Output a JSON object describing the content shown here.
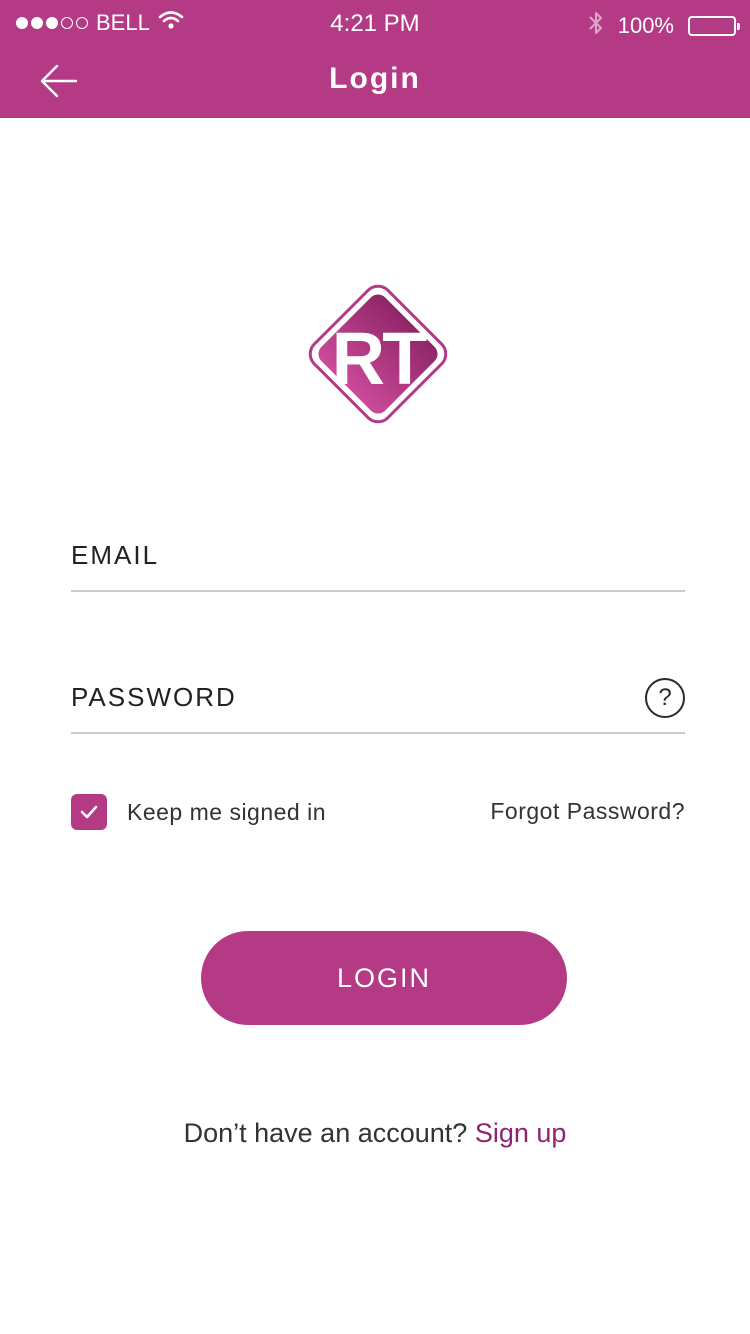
{
  "status_bar": {
    "carrier": "BELL",
    "time": "4:21 PM",
    "battery": "100%",
    "signal_bars_filled": 3,
    "signal_bars_total": 5
  },
  "navbar": {
    "title": "Login",
    "back_icon": "arrow-left-icon"
  },
  "logo": {
    "text": "RT",
    "color": "#b53a86"
  },
  "form": {
    "email_label": "EMAIL",
    "password_label": "PASSWORD",
    "help_icon": "question-circle-icon",
    "keep_signed_in_label": "Keep me signed in",
    "keep_signed_in_checked": true,
    "forgot_password_label": "Forgot Password?",
    "login_button_label": "LOGIN"
  },
  "footer": {
    "prompt": "Don’t have an account?",
    "signup_label": "Sign up"
  },
  "colors": {
    "accent": "#b53a86",
    "link": "#8e2470"
  }
}
